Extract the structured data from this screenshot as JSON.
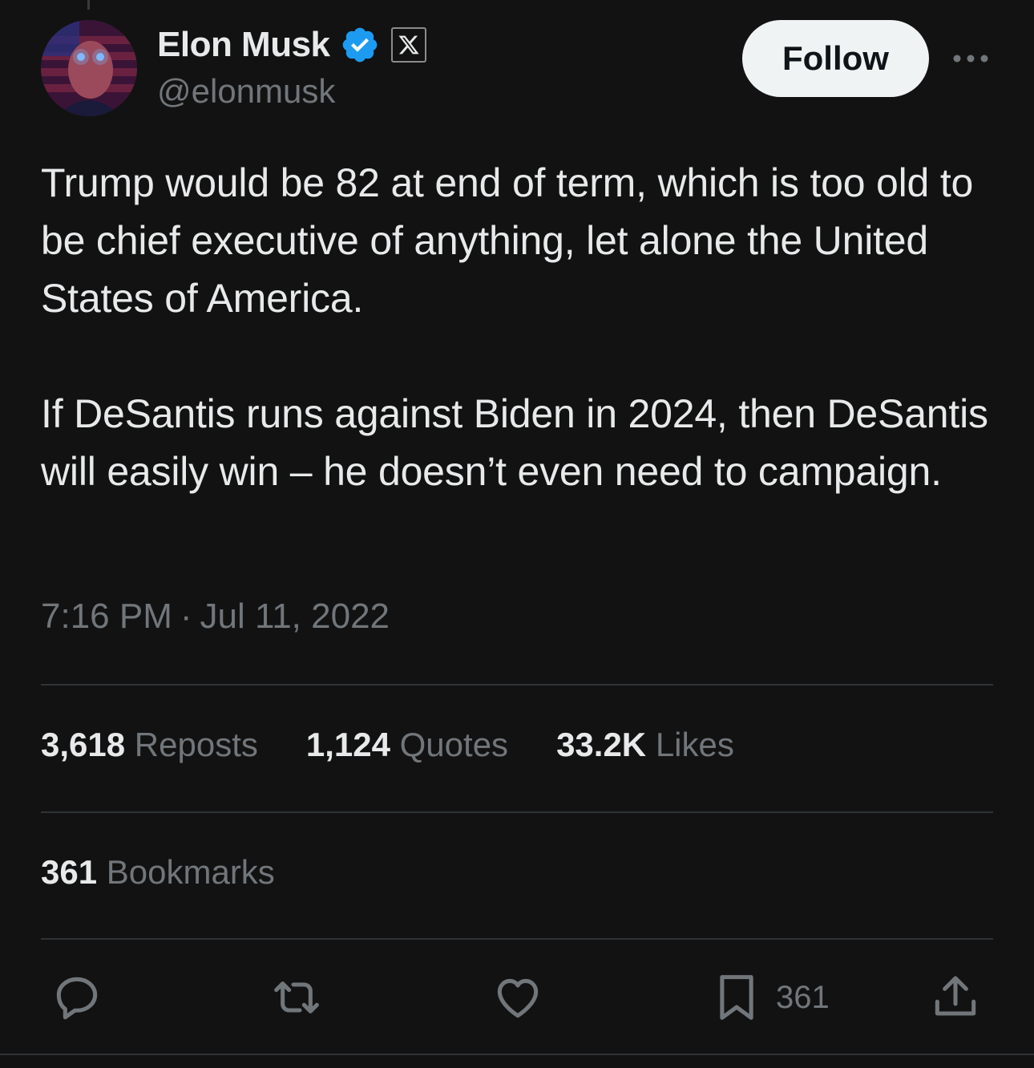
{
  "author": {
    "display_name": "Elon Musk",
    "handle": "@elonmusk",
    "verified_badge_color": "#1d9bf0",
    "affiliate_badge": "x-logo-icon"
  },
  "header": {
    "follow_label": "Follow",
    "more_icon": "more-horizontal-icon"
  },
  "tweet": {
    "text": "Trump would be 82 at end of term, which is too old to be chief executive of anything, let alone the United States of America.\n\nIf DeSantis runs against Biden in 2024, then DeSantis will easily win – he doesn’t even need to campaign.",
    "time": "7:16 PM",
    "separator": "·",
    "date": "Jul 11, 2022"
  },
  "stats": {
    "reposts_count": "3,618",
    "reposts_label": "Reposts",
    "quotes_count": "1,124",
    "quotes_label": "Quotes",
    "likes_count": "33.2K",
    "likes_label": "Likes",
    "bookmarks_count": "361",
    "bookmarks_label": "Bookmarks"
  },
  "actions": {
    "reply_icon": "reply-icon",
    "repost_icon": "repost-icon",
    "like_icon": "heart-icon",
    "bookmark_icon": "bookmark-icon",
    "bookmark_count": "361",
    "share_icon": "share-icon"
  },
  "colors": {
    "background": "#121212",
    "text_primary": "#e7e9ea",
    "text_secondary": "#71767b",
    "divider": "#2f3336",
    "follow_bg": "#eff3f4"
  }
}
